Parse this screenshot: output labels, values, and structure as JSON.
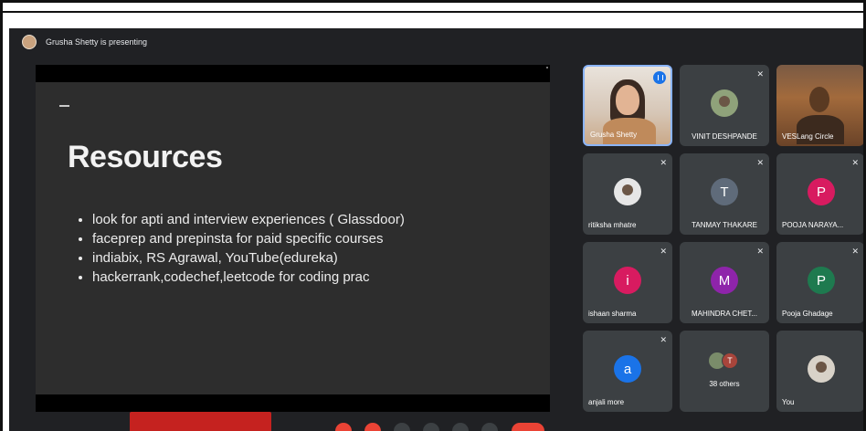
{
  "presenter": {
    "banner_text": "Grusha Shetty is presenting"
  },
  "slide": {
    "title": "Resources",
    "bullets": [
      "look for apti and interview experiences ( Glassdoor)",
      "faceprep and prepinsta for paid specific courses",
      "indiabix, RS Agrawal, YouTube(edureka)",
      "hackerrank,codechef,leetcode for coding prac"
    ]
  },
  "participants": [
    {
      "name": "Grusha Shetty",
      "type": "video",
      "speaking": true
    },
    {
      "name": "VINIT DESHPANDE",
      "type": "photo",
      "muted": true
    },
    {
      "name": "VESLang Circle",
      "type": "video"
    },
    {
      "name": "ritiksha mhatre",
      "type": "photo",
      "muted": true
    },
    {
      "name": "TANMAY THAKARE",
      "type": "letter",
      "letter": "T",
      "color": "#5f6b7a",
      "muted": true
    },
    {
      "name": "POOJA NARAYA...",
      "type": "letter",
      "letter": "P",
      "color": "#d81b60",
      "muted": true
    },
    {
      "name": "ishaan sharma",
      "type": "letter",
      "letter": "i",
      "color": "#d81b60",
      "muted": true
    },
    {
      "name": "MAHINDRA CHET...",
      "type": "letter",
      "letter": "M",
      "color": "#8e24aa",
      "muted": true
    },
    {
      "name": "Pooja Ghadage",
      "type": "letter",
      "letter": "P",
      "color": "#1e7a4f",
      "muted": true
    },
    {
      "name": "anjali more",
      "type": "letter",
      "letter": "a",
      "color": "#1a73e8",
      "muted": true
    },
    {
      "name": "38 others",
      "type": "others",
      "letter": "T"
    },
    {
      "name": "You",
      "type": "photo"
    }
  ],
  "icons": {
    "mic_off": "✕",
    "colors": {
      "accent_red": "#ea4335",
      "speaking_blue": "#1a73e8"
    }
  }
}
